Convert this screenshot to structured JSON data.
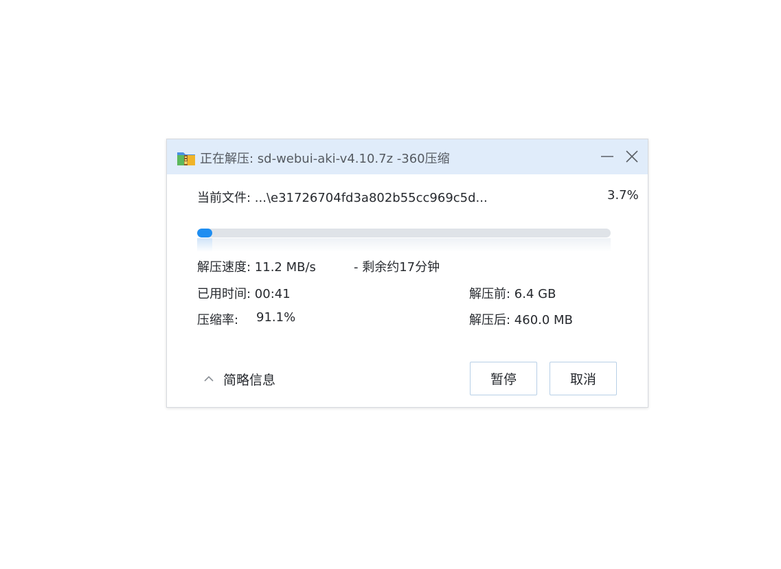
{
  "window": {
    "title": "正在解压: sd-webui-aki-v4.10.7z -360压缩",
    "app_icon": "360zip-archive-icon",
    "minimize_icon": "minimize-icon",
    "close_icon": "close-icon"
  },
  "current_file": {
    "label": "当前文件: ...\\e31726704fd3a802b55cc969c5d...",
    "percent_text": "3.7%"
  },
  "progress": {
    "fraction": 0.037,
    "color": "#1f8ef1",
    "track_color": "#dfe3e8"
  },
  "stats": {
    "speed": "解压速度: 11.2 MB/s",
    "remaining": "- 剩余约17分钟",
    "elapsed": "已用时间: 00:41",
    "before_size": "解压前: 6.4 GB",
    "ratio_label": "压缩率:",
    "ratio_value": "91.1%",
    "after_size": "解压后: 460.0 MB"
  },
  "footer": {
    "summary_toggle_icon": "chevron-up-icon",
    "summary_toggle_label": "简略信息",
    "pause_label": "暂停",
    "cancel_label": "取消"
  },
  "colors": {
    "titlebar": "#e0ecfa",
    "button_border": "#b7cfe6"
  }
}
